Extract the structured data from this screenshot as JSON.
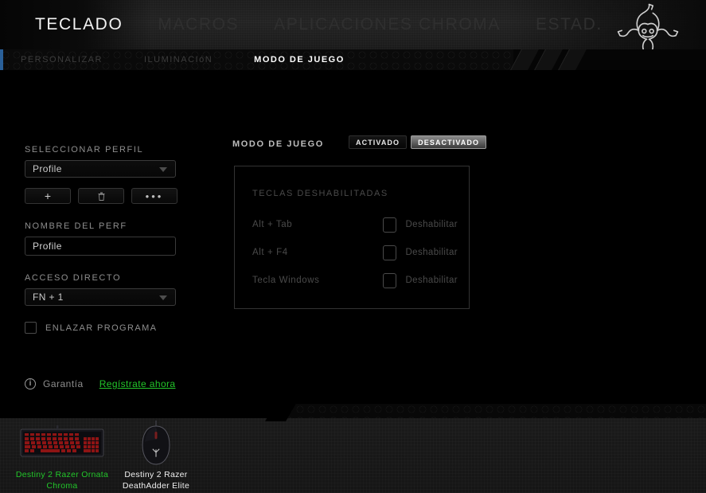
{
  "header": {
    "main_tabs": [
      {
        "label": "TECLADO",
        "active": true
      },
      {
        "label": "MACROS",
        "active": false
      },
      {
        "label": "APLICACIONES CHROMA",
        "active": false
      },
      {
        "label": "ESTAD.",
        "active": false
      }
    ],
    "logo_name": "razer-logo"
  },
  "subnav": {
    "tabs": [
      {
        "label": "PERSONALIZAR",
        "active": false
      },
      {
        "label": "ILUMINACIóN",
        "active": false
      },
      {
        "label": "MODO DE JUEGO",
        "active": true
      }
    ]
  },
  "profile_panel": {
    "select_profile_label": "SELECCIONAR PERFIL",
    "selected_profile": "Profile",
    "buttons": [
      {
        "name": "add-profile-button",
        "glyph": "+"
      },
      {
        "name": "delete-profile-button",
        "glyph": "trash"
      },
      {
        "name": "more-options-button",
        "glyph": "..."
      }
    ],
    "profile_name_label": "NOMBRE DEL PERF",
    "profile_name_value": "Profile",
    "profile_name_placeholder": "Profile",
    "shortcut_label": "ACCESO DIRECTO",
    "shortcut_value": "FN + 1",
    "link_program_label": "ENLAZAR PROGRAMA",
    "link_program_checked": false
  },
  "game_mode": {
    "title": "MODO DE JUEGO",
    "toggle_on_label": "ACTIVADO",
    "toggle_off_label": "DESACTIVADO",
    "selected_toggle": "DESACTIVADO",
    "disabled_keys_title": "TECLAS DESHABILITADAS",
    "rows": [
      {
        "key": "Alt + Tab",
        "action": "Deshabilitar",
        "checked": false
      },
      {
        "key": "Alt + F4",
        "action": "Deshabilitar",
        "checked": false
      },
      {
        "key": "Tecla Windows",
        "action": "Deshabilitar",
        "checked": false
      }
    ]
  },
  "warranty": {
    "label": "Garantía",
    "link": "Regístrate ahora",
    "link_color": "#22c62a"
  },
  "devices": [
    {
      "name": "Destiny 2 Razer Ornata\nChroma",
      "selected": true,
      "type": "keyboard"
    },
    {
      "name": "Destiny 2 Razer\nDeathAdder Elite",
      "selected": false,
      "type": "mouse"
    }
  ]
}
